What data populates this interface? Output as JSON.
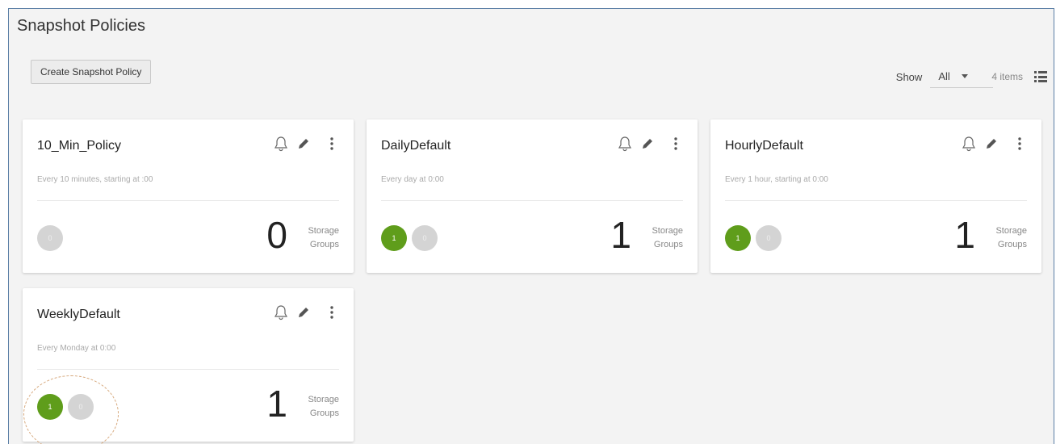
{
  "page": {
    "title": "Snapshot Policies",
    "create_button": "Create Snapshot Policy",
    "show_label": "Show",
    "show_value": "All",
    "item_count": "4 items"
  },
  "colors": {
    "accent_green": "#5f9d1b",
    "badge_gray": "#d4d4d4",
    "frame_border": "#5b7fa6"
  },
  "icons": {
    "bell": "bell-icon",
    "edit": "pencil-icon",
    "more": "more-vertical-icon",
    "list_view": "list-view-icon"
  },
  "cards": [
    {
      "title": "10_Min_Policy",
      "description": "Every 10 minutes, starting at :00",
      "badges": [
        "0"
      ],
      "count": "0",
      "count_label_1": "Storage",
      "count_label_2": "Groups"
    },
    {
      "title": "DailyDefault",
      "description": "Every day at 0:00",
      "badges": [
        "1",
        "0"
      ],
      "count": "1",
      "count_label_1": "Storage",
      "count_label_2": "Groups"
    },
    {
      "title": "HourlyDefault",
      "description": "Every 1 hour, starting at 0:00",
      "badges": [
        "1",
        "0"
      ],
      "count": "1",
      "count_label_1": "Storage",
      "count_label_2": "Groups"
    },
    {
      "title": "WeeklyDefault",
      "description": "Every Monday at 0:00",
      "badges": [
        "1",
        "0"
      ],
      "count": "1",
      "count_label_1": "Storage",
      "count_label_2": "Groups"
    }
  ]
}
